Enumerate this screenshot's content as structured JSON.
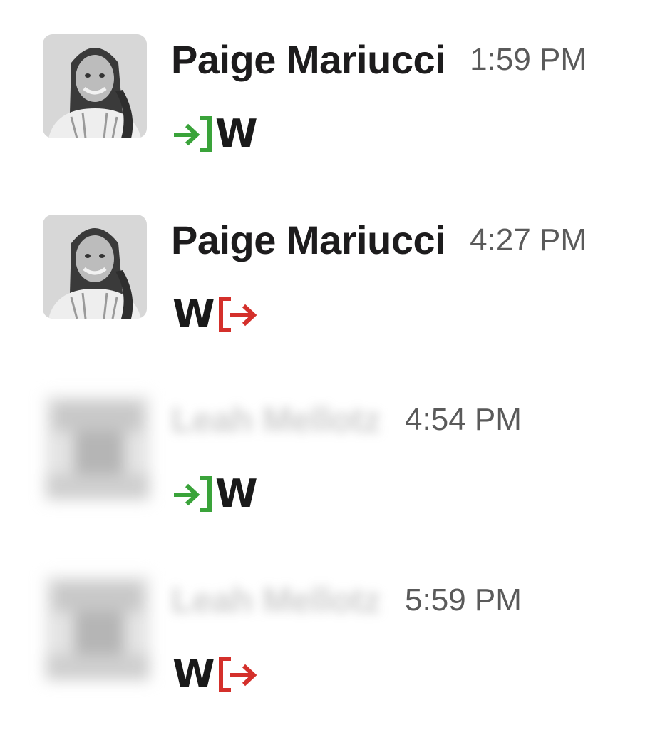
{
  "messages": [
    {
      "sender": "Paige Mariucci",
      "time": "1:59 PM",
      "avatar_blurred": false,
      "status_icons": [
        "clock-in-arrow-icon",
        "W"
      ]
    },
    {
      "sender": "Paige Mariucci",
      "time": "4:27 PM",
      "avatar_blurred": false,
      "status_icons": [
        "W",
        "clock-out-arrow-icon"
      ]
    },
    {
      "sender": "Leah Mellotz",
      "time": "4:54 PM",
      "avatar_blurred": true,
      "status_icons": [
        "clock-in-arrow-icon",
        "W"
      ]
    },
    {
      "sender": "Leah Mellotz",
      "time": "5:59 PM",
      "avatar_blurred": true,
      "status_icons": [
        "W",
        "clock-out-arrow-icon"
      ]
    }
  ],
  "workspace_letter": "W",
  "colors": {
    "clock_in_green": "#3aa33a",
    "clock_out_red": "#d4302b",
    "sender_text": "#1d1c1d",
    "timestamp_text": "#5a5a5a"
  }
}
